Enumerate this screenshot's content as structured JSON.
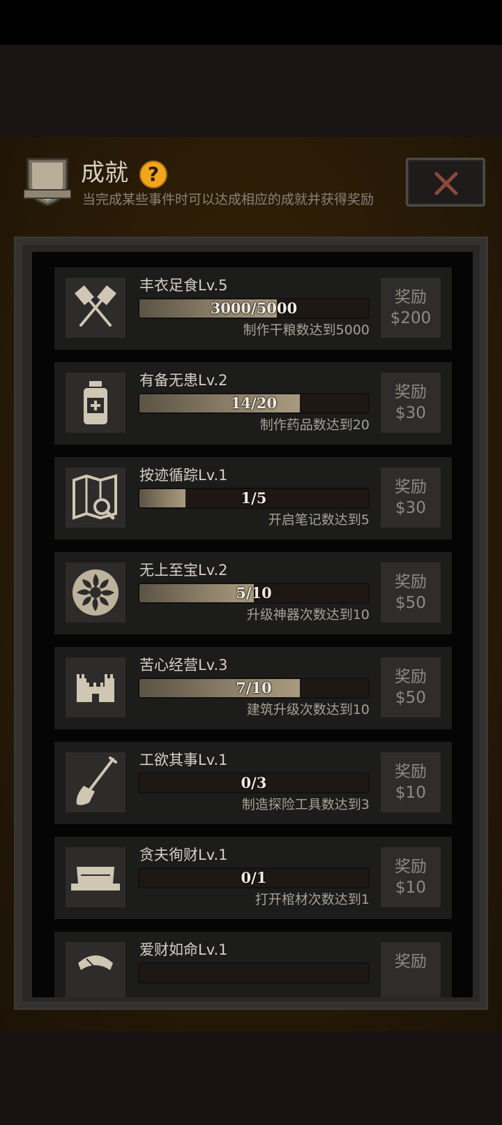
{
  "header": {
    "title": "成就",
    "subtitle": "当完成某些事件时可以达成相应的成就并获得奖励"
  },
  "colors": {
    "accent": "#f2a51b",
    "close": "#8a4a3a",
    "text": "#d6d0c6"
  },
  "achievements": [
    {
      "icon": "crossed-spatulas-icon",
      "name": "丰衣足食Lv.5",
      "progress_text": "3000/5000",
      "progress": 0.6,
      "desc": "制作干粮数达到5000",
      "reward_label": "奖励",
      "reward": "$200"
    },
    {
      "icon": "medicine-bottle-icon",
      "name": "有备无患Lv.2",
      "progress_text": "14/20",
      "progress": 0.7,
      "desc": "制作药品数达到20",
      "reward_label": "奖励",
      "reward": "$30"
    },
    {
      "icon": "map-search-icon",
      "name": "按迹循踪Lv.1",
      "progress_text": "1/5",
      "progress": 0.2,
      "desc": "开启笔记数达到5",
      "reward_label": "奖励",
      "reward": "$30"
    },
    {
      "icon": "ornament-emblem-icon",
      "name": "无上至宝Lv.2",
      "progress_text": "5/10",
      "progress": 0.5,
      "desc": "升级神器次数达到10",
      "reward_label": "奖励",
      "reward": "$50"
    },
    {
      "icon": "castle-icon",
      "name": "苦心经营Lv.3",
      "progress_text": "7/10",
      "progress": 0.7,
      "desc": "建筑升级次数达到10",
      "reward_label": "奖励",
      "reward": "$50"
    },
    {
      "icon": "shovel-icon",
      "name": "工欲其事Lv.1",
      "progress_text": "0/3",
      "progress": 0,
      "desc": "制造探险工具数达到3",
      "reward_label": "奖励",
      "reward": "$10"
    },
    {
      "icon": "coffin-icon",
      "name": "贪夫徇财Lv.1",
      "progress_text": "0/1",
      "progress": 0,
      "desc": "打开棺材次数达到1",
      "reward_label": "奖励",
      "reward": "$10"
    },
    {
      "icon": "coin-purse-icon",
      "name": "爱财如命Lv.1",
      "progress_text": "",
      "progress": 0,
      "desc": "",
      "reward_label": "奖励",
      "reward": ""
    }
  ]
}
